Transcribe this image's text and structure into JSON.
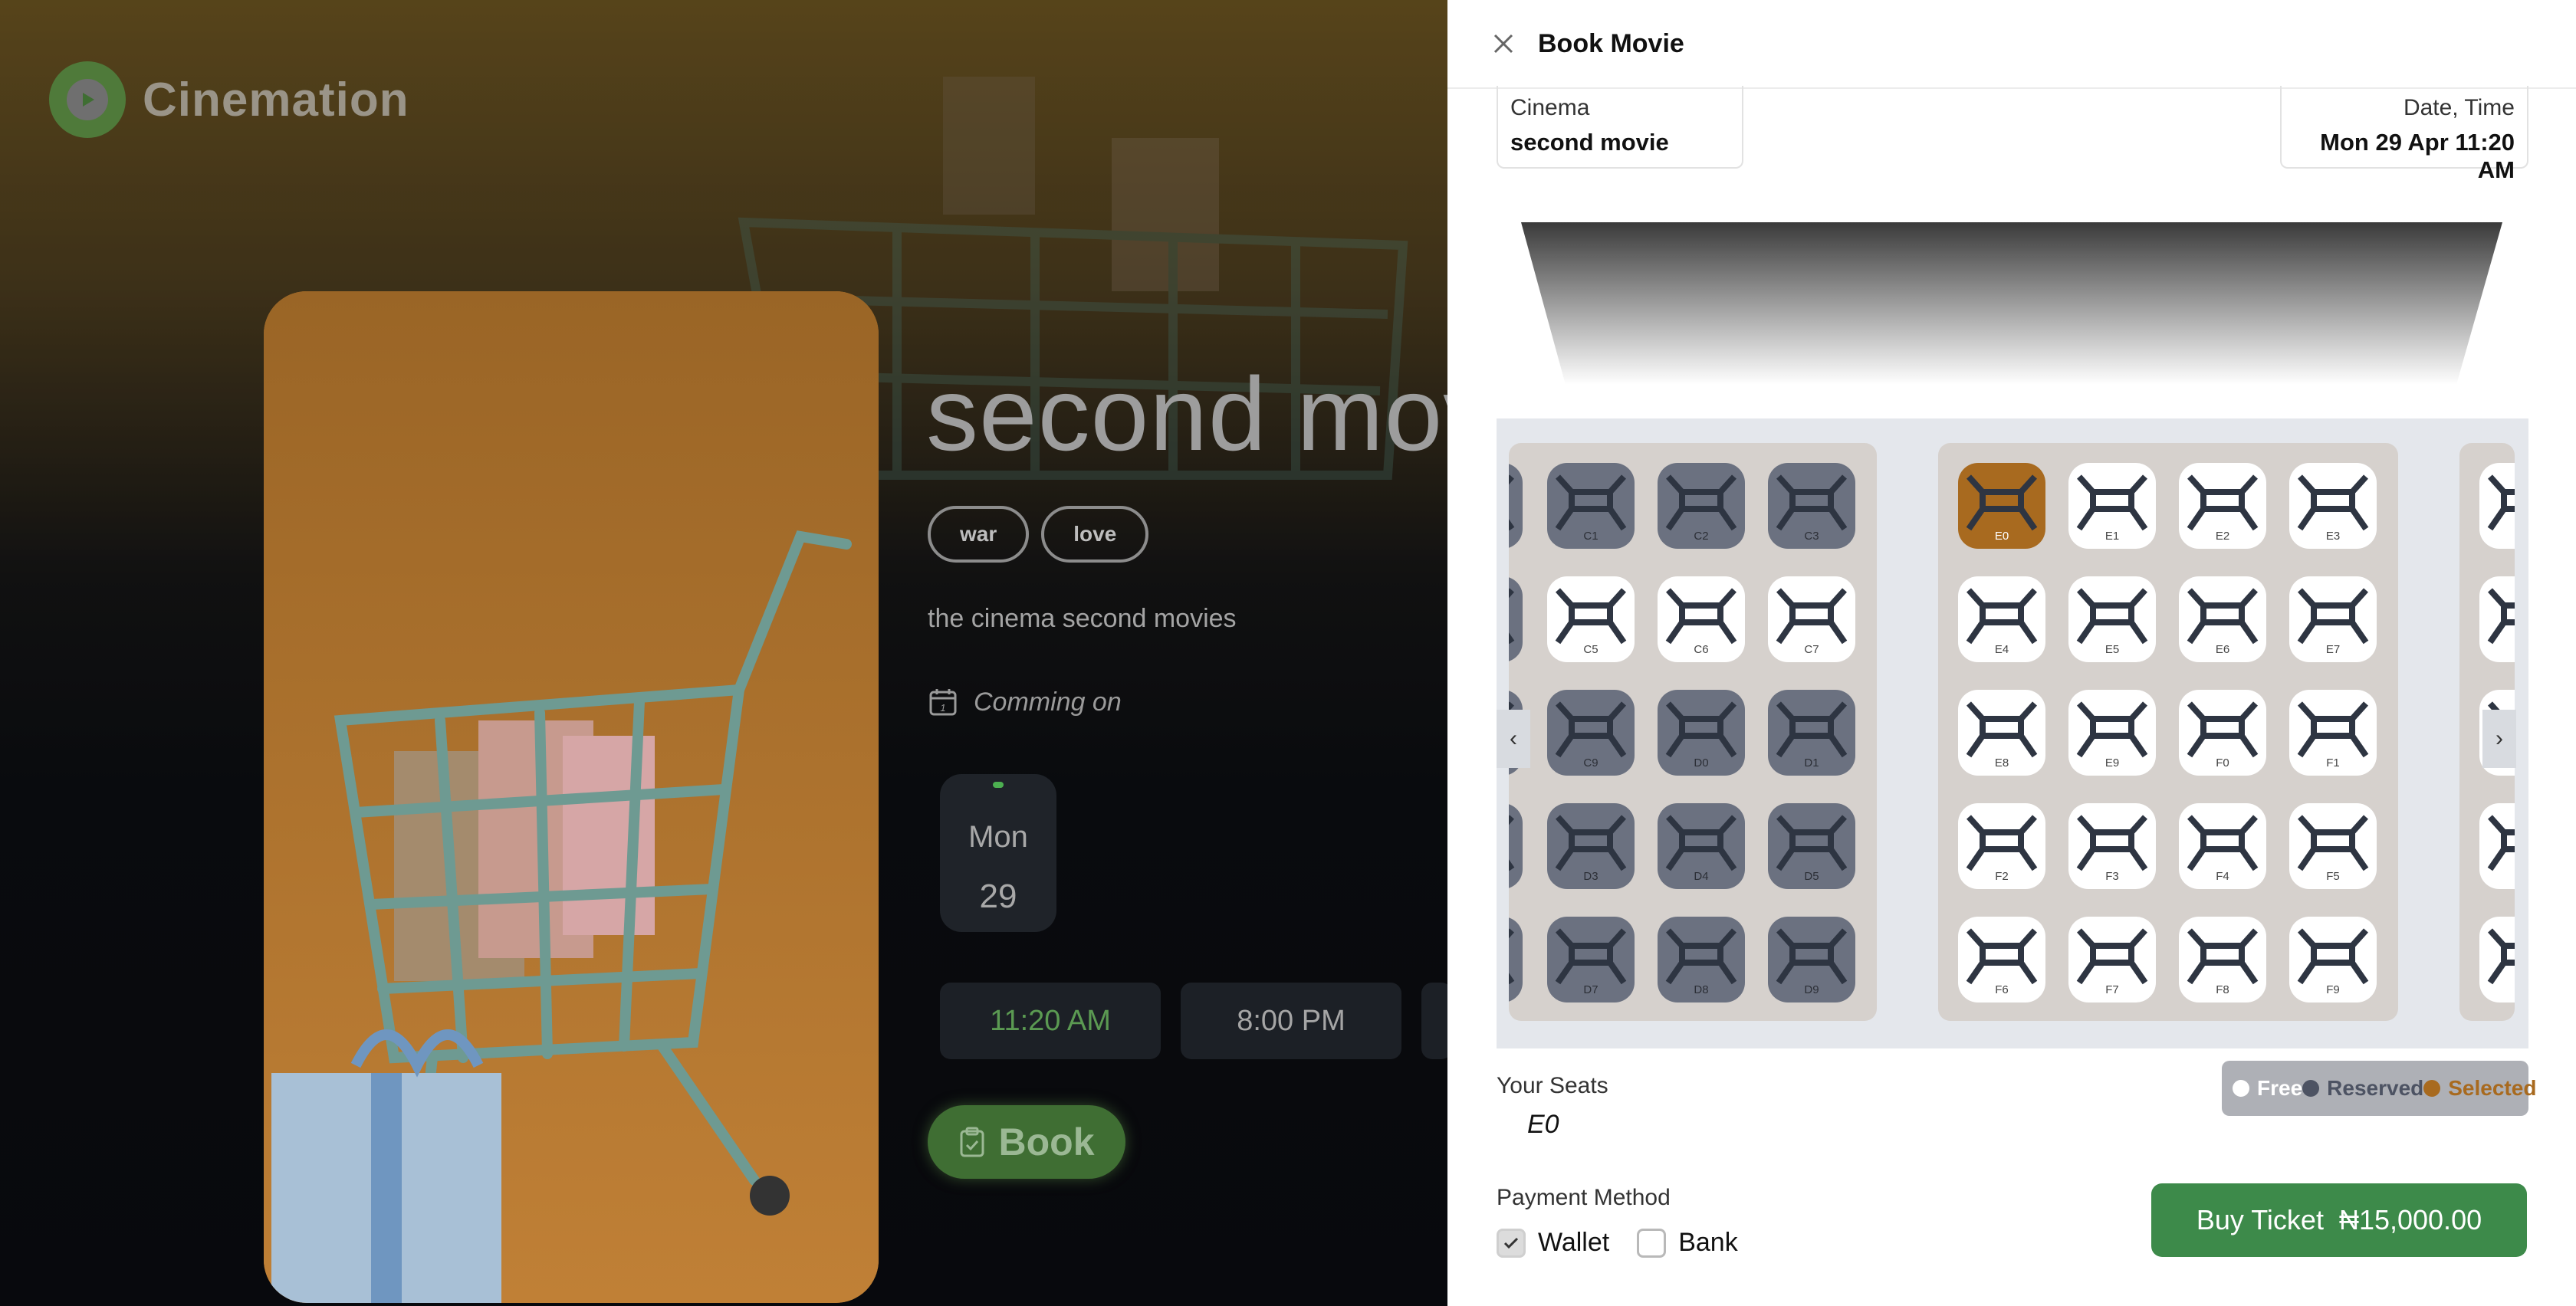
{
  "app": {
    "brand": "Cinemation"
  },
  "movie": {
    "title": "second movie",
    "tags": [
      "war",
      "love"
    ],
    "description": "the cinema second movies",
    "coming_label": "Comming on",
    "date": {
      "day": "Mon",
      "num": "29"
    },
    "times": [
      "11:20 AM",
      "8:00 PM"
    ],
    "book_label": "Book"
  },
  "modal": {
    "title": "Book Movie",
    "cinema": {
      "label": "Cinema",
      "value": "second movie"
    },
    "datetime": {
      "label": "Date, Time",
      "value": "Mon 29 Apr 11:20 AM"
    }
  },
  "seats": {
    "block1": [
      {
        "id": "C1",
        "status": "reserved"
      },
      {
        "id": "C2",
        "status": "reserved"
      },
      {
        "id": "C3",
        "status": "reserved"
      },
      {
        "id": "C5",
        "status": "free"
      },
      {
        "id": "C6",
        "status": "free"
      },
      {
        "id": "C7",
        "status": "free"
      },
      {
        "id": "C9",
        "status": "reserved"
      },
      {
        "id": "D0",
        "status": "reserved"
      },
      {
        "id": "D1",
        "status": "reserved"
      },
      {
        "id": "D3",
        "status": "reserved"
      },
      {
        "id": "D4",
        "status": "reserved"
      },
      {
        "id": "D5",
        "status": "reserved"
      },
      {
        "id": "D7",
        "status": "reserved"
      },
      {
        "id": "D8",
        "status": "reserved"
      },
      {
        "id": "D9",
        "status": "reserved"
      }
    ],
    "block1_edge": [
      "reserved",
      "reserved",
      "reserved",
      "reserved",
      "reserved"
    ],
    "block2": [
      {
        "id": "E0",
        "status": "selected"
      },
      {
        "id": "E1",
        "status": "free"
      },
      {
        "id": "E2",
        "status": "free"
      },
      {
        "id": "E3",
        "status": "free"
      },
      {
        "id": "E4",
        "status": "free"
      },
      {
        "id": "E5",
        "status": "free"
      },
      {
        "id": "E6",
        "status": "free"
      },
      {
        "id": "E7",
        "status": "free"
      },
      {
        "id": "E8",
        "status": "free"
      },
      {
        "id": "E9",
        "status": "free"
      },
      {
        "id": "F0",
        "status": "free"
      },
      {
        "id": "F1",
        "status": "free"
      },
      {
        "id": "F2",
        "status": "free"
      },
      {
        "id": "F3",
        "status": "free"
      },
      {
        "id": "F4",
        "status": "free"
      },
      {
        "id": "F5",
        "status": "free"
      },
      {
        "id": "F6",
        "status": "free"
      },
      {
        "id": "F7",
        "status": "free"
      },
      {
        "id": "F8",
        "status": "free"
      },
      {
        "id": "F9",
        "status": "free"
      }
    ]
  },
  "legend": {
    "free": "Free",
    "reserved": "Reserved",
    "selected": "Selected"
  },
  "colors": {
    "free": "#ffffff",
    "reserved": "#6b7180",
    "selected": "#a86a1f",
    "accent": "#3d8a4a"
  },
  "your_seats": {
    "label": "Your Seats",
    "value": "E0"
  },
  "payment": {
    "label": "Payment Method",
    "options": [
      "Wallet",
      "Bank"
    ],
    "selected": "Wallet"
  },
  "buy": {
    "label": "Buy Ticket",
    "price": "₦15,000.00"
  }
}
